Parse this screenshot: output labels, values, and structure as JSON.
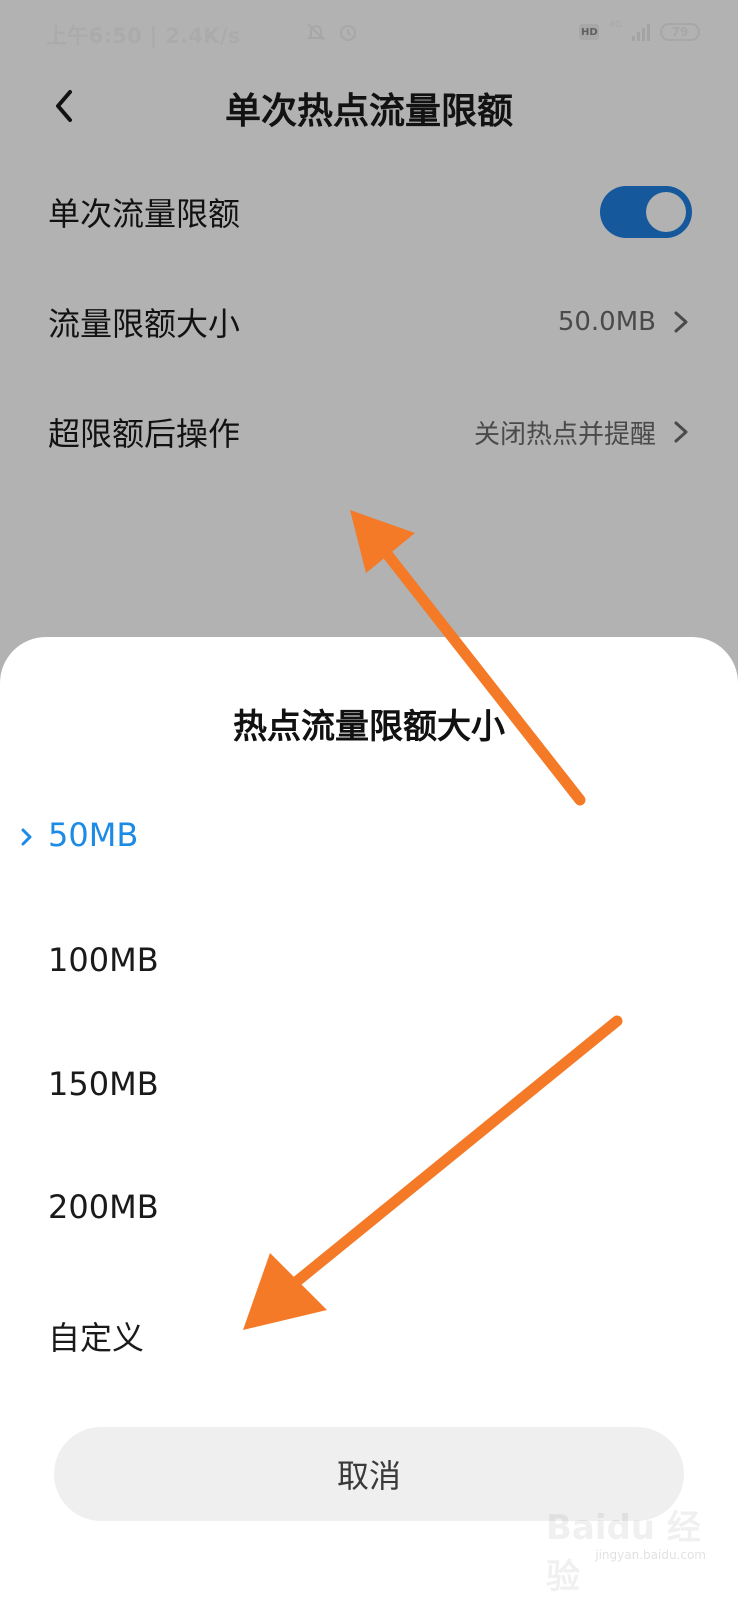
{
  "status_bar": {
    "time": "上午6:50 | 2.4K/s",
    "hd": "HD",
    "network": "4G",
    "battery": "79",
    "icons": [
      "mute-icon",
      "alarm-icon",
      "signal-icon",
      "battery-icon"
    ]
  },
  "header": {
    "back_icon": "chevron-left-icon",
    "title": "单次热点流量限额"
  },
  "settings": {
    "rows": [
      {
        "label": "单次流量限额",
        "toggle_on": true
      },
      {
        "label": "流量限额大小",
        "value": "50.0MB"
      },
      {
        "label": "超限额后操作",
        "value": "关闭热点并提醒"
      }
    ]
  },
  "sheet": {
    "title": "热点流量限额大小",
    "options": [
      {
        "label": "50MB",
        "selected": true
      },
      {
        "label": "100MB"
      },
      {
        "label": "150MB"
      },
      {
        "label": "200MB"
      },
      {
        "label": "自定义"
      }
    ],
    "cancel_label": "取消"
  },
  "watermark": {
    "text": "Baidu 经验",
    "url": "jingyan.baidu.com"
  },
  "colors": {
    "accent": "#1c8be6",
    "toggle": "#1f7fe0",
    "annotation_arrow": "#f47a28",
    "overlay": "#b3b3b3"
  }
}
